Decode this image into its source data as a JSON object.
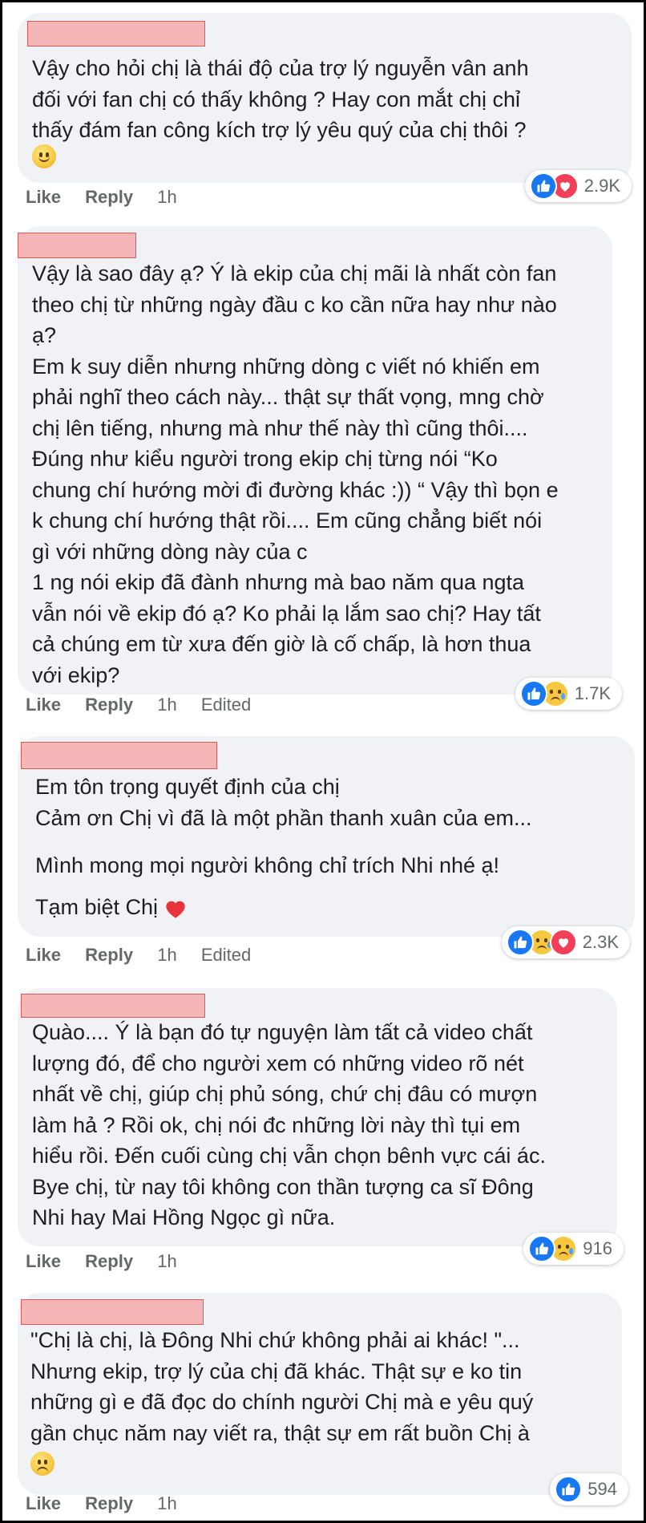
{
  "comments": [
    {
      "lines": "Vậy cho hỏi chị là thái độ của trợ lý nguyễn vân anh\nđối với fan chị có thấy không ? Hay con mắt chị chỉ\nthấy đám fan công kích trợ lý yêu quý của chị thôi ?",
      "emoji": "slightly-smiling-face-icon",
      "actions": {
        "like": "Like",
        "reply": "Reply",
        "time": "1h",
        "edited": ""
      },
      "reactions": {
        "icons": [
          "like",
          "love"
        ],
        "count": "2.9K"
      }
    },
    {
      "lines": "Vậy là sao đây ạ? Ý là ekip của chị mãi là nhất còn fan\ntheo chị từ những ngày đầu c ko cần nữa hay như nào\nạ?\nEm k suy diễn nhưng những dòng c viết nó khiến em\nphải nghĩ theo cách này... thật sự thất vọng, mng chờ\nchị lên tiếng, nhưng mà như thế này thì cũng thôi....\nĐúng như kiểu người trong ekip chị từng nói “Ko\nchung chí hướng mời đi đường khác :)) “ Vậy thì bọn e\nk chung chí hướng thật rồi.... Em cũng chẳng biết nói\ngì với những dòng này của c\n1 ng nói ekip đã đành nhưng mà bao năm qua ngta\nvẫn nói về ekip đó ạ? Ko phải lạ lắm sao chị? Hay tất\ncả chúng em từ xưa đến giờ là cố chấp, là hơn thua\nvới ekip?",
      "actions": {
        "like": "Like",
        "reply": "Reply",
        "time": "1h",
        "edited": "Edited"
      },
      "reactions": {
        "icons": [
          "like",
          "sad"
        ],
        "count": "1.7K"
      }
    },
    {
      "lines": "Em tôn trọng quyết định của chị\nCảm ơn Chị vì đã là một phần thanh xuân của em...",
      "line2": "Mình mong mọi người không chỉ trích Nhi nhé ạ!",
      "line3": "Tạm biệt Chị",
      "actions": {
        "like": "Like",
        "reply": "Reply",
        "time": "1h",
        "edited": "Edited"
      },
      "reactions": {
        "icons": [
          "like",
          "sad",
          "love"
        ],
        "count": "2.3K"
      }
    },
    {
      "lines": "Quào.... Ý là bạn đó tự nguyện làm tất cả video chất\nlượng đó, để cho người xem có những video rõ nét\nnhất về chị, giúp chị phủ sóng, chứ chị đâu có mượn\nlàm hả ? Rồi ok, chị nói đc những lời này thì tụi em\nhiểu rồi. Đến cuối cùng chị vẫn chọn bênh vực cái ác.\nBye chị, từ nay tôi không con thần tượng ca sĩ Đông\nNhi hay Mai Hồng Ngọc gì nữa.",
      "actions": {
        "like": "Like",
        "reply": "Reply",
        "time": "1h",
        "edited": ""
      },
      "reactions": {
        "icons": [
          "like",
          "sad"
        ],
        "count": "916"
      }
    },
    {
      "lines": "\"Chị là chị, là Đông Nhi chứ không phải ai khác! \"...\nNhưng ekip, trợ lý của chị đã khác. Thật sự e ko tin\nnhững gì e đã đọc do chính người Chị mà e yêu quý\ngần chục năm nay viết ra, thật sự em rất buồn Chị à",
      "emoji": "pensive-face-icon",
      "actions": {
        "like": "Like",
        "reply": "Reply",
        "time": "1h",
        "edited": ""
      },
      "reactions": {
        "icons": [
          "like"
        ],
        "count": "594"
      }
    }
  ]
}
